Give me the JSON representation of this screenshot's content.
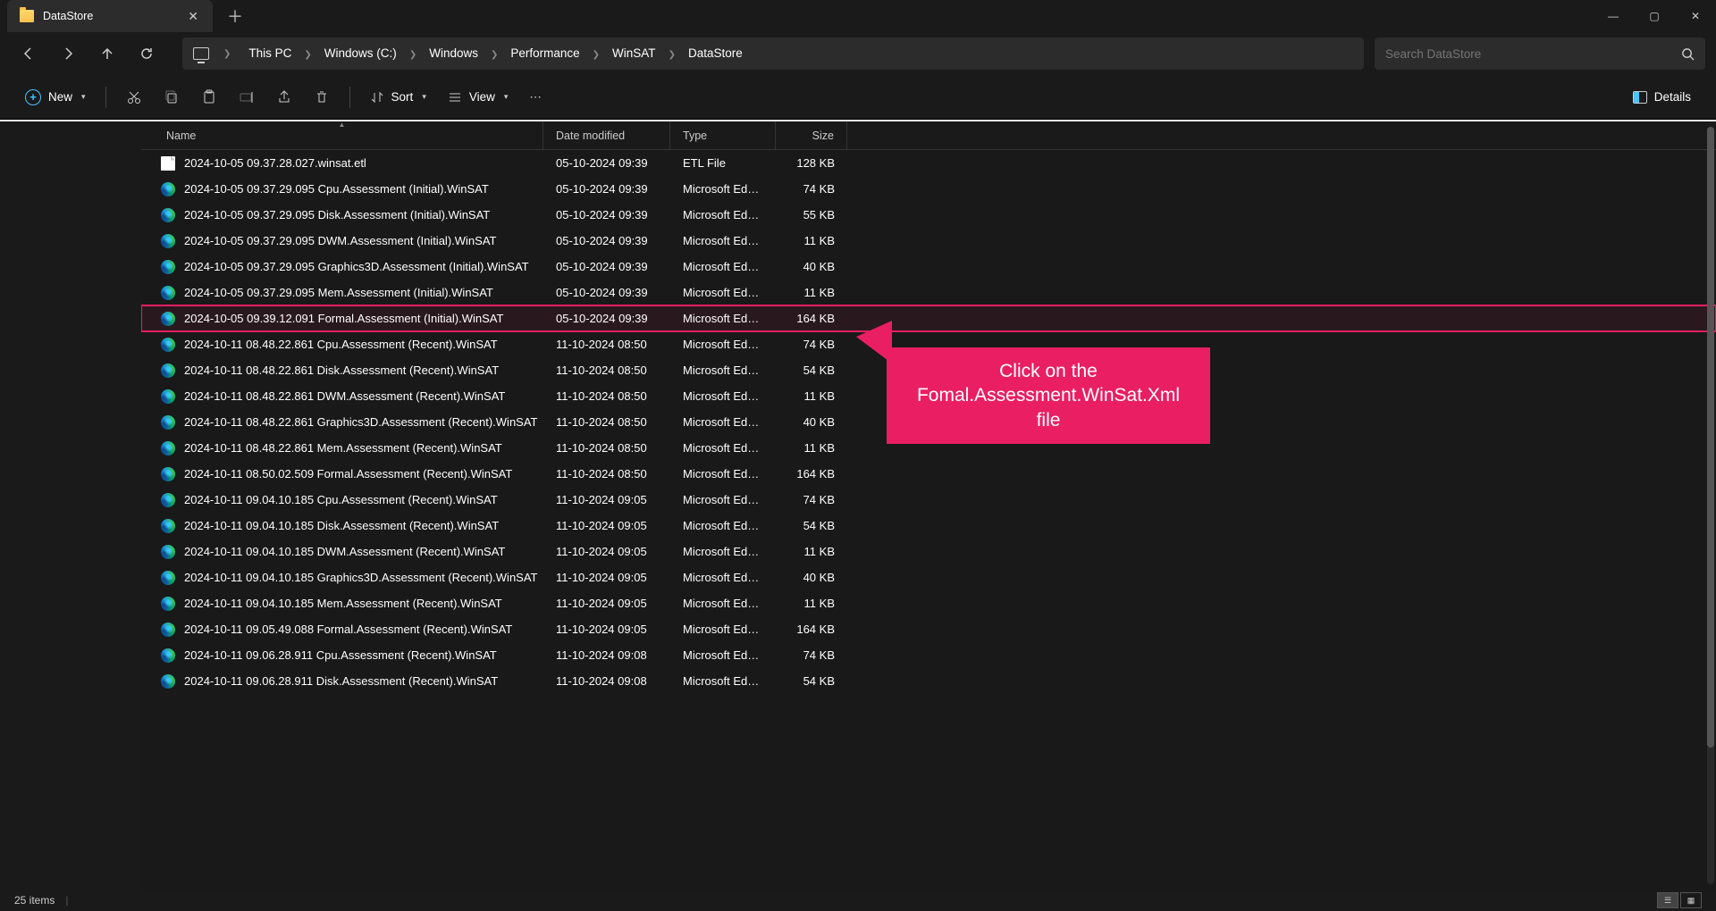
{
  "titlebar": {
    "tab_title": "DataStore"
  },
  "breadcrumb": {
    "items": [
      "This PC",
      "Windows (C:)",
      "Windows",
      "Performance",
      "WinSAT",
      "DataStore"
    ]
  },
  "search": {
    "placeholder": "Search DataStore"
  },
  "toolbar": {
    "new_label": "New",
    "sort_label": "Sort",
    "view_label": "View",
    "details_label": "Details"
  },
  "columns": {
    "name": "Name",
    "date": "Date modified",
    "type": "Type",
    "size": "Size"
  },
  "files": [
    {
      "icon": "etl",
      "name": "2024-10-05 09.37.28.027.winsat.etl",
      "date": "05-10-2024 09:39",
      "type": "ETL File",
      "size": "128 KB",
      "hl": false
    },
    {
      "icon": "edge",
      "name": "2024-10-05 09.37.29.095 Cpu.Assessment (Initial).WinSAT",
      "date": "05-10-2024 09:39",
      "type": "Microsoft Edge HT...",
      "size": "74 KB",
      "hl": false
    },
    {
      "icon": "edge",
      "name": "2024-10-05 09.37.29.095 Disk.Assessment (Initial).WinSAT",
      "date": "05-10-2024 09:39",
      "type": "Microsoft Edge HT...",
      "size": "55 KB",
      "hl": false
    },
    {
      "icon": "edge",
      "name": "2024-10-05 09.37.29.095 DWM.Assessment (Initial).WinSAT",
      "date": "05-10-2024 09:39",
      "type": "Microsoft Edge HT...",
      "size": "11 KB",
      "hl": false
    },
    {
      "icon": "edge",
      "name": "2024-10-05 09.37.29.095 Graphics3D.Assessment (Initial).WinSAT",
      "date": "05-10-2024 09:39",
      "type": "Microsoft Edge HT...",
      "size": "40 KB",
      "hl": false
    },
    {
      "icon": "edge",
      "name": "2024-10-05 09.37.29.095 Mem.Assessment (Initial).WinSAT",
      "date": "05-10-2024 09:39",
      "type": "Microsoft Edge HT...",
      "size": "11 KB",
      "hl": false
    },
    {
      "icon": "edge",
      "name": "2024-10-05 09.39.12.091 Formal.Assessment (Initial).WinSAT",
      "date": "05-10-2024 09:39",
      "type": "Microsoft Edge HT...",
      "size": "164 KB",
      "hl": true
    },
    {
      "icon": "edge",
      "name": "2024-10-11 08.48.22.861 Cpu.Assessment (Recent).WinSAT",
      "date": "11-10-2024 08:50",
      "type": "Microsoft Edge HT...",
      "size": "74 KB",
      "hl": false
    },
    {
      "icon": "edge",
      "name": "2024-10-11 08.48.22.861 Disk.Assessment (Recent).WinSAT",
      "date": "11-10-2024 08:50",
      "type": "Microsoft Edge HT...",
      "size": "54 KB",
      "hl": false
    },
    {
      "icon": "edge",
      "name": "2024-10-11 08.48.22.861 DWM.Assessment (Recent).WinSAT",
      "date": "11-10-2024 08:50",
      "type": "Microsoft Edge HT...",
      "size": "11 KB",
      "hl": false
    },
    {
      "icon": "edge",
      "name": "2024-10-11 08.48.22.861 Graphics3D.Assessment (Recent).WinSAT",
      "date": "11-10-2024 08:50",
      "type": "Microsoft Edge HT...",
      "size": "40 KB",
      "hl": false
    },
    {
      "icon": "edge",
      "name": "2024-10-11 08.48.22.861 Mem.Assessment (Recent).WinSAT",
      "date": "11-10-2024 08:50",
      "type": "Microsoft Edge HT...",
      "size": "11 KB",
      "hl": false
    },
    {
      "icon": "edge",
      "name": "2024-10-11 08.50.02.509 Formal.Assessment (Recent).WinSAT",
      "date": "11-10-2024 08:50",
      "type": "Microsoft Edge HT...",
      "size": "164 KB",
      "hl": false
    },
    {
      "icon": "edge",
      "name": "2024-10-11 09.04.10.185 Cpu.Assessment (Recent).WinSAT",
      "date": "11-10-2024 09:05",
      "type": "Microsoft Edge HT...",
      "size": "74 KB",
      "hl": false
    },
    {
      "icon": "edge",
      "name": "2024-10-11 09.04.10.185 Disk.Assessment (Recent).WinSAT",
      "date": "11-10-2024 09:05",
      "type": "Microsoft Edge HT...",
      "size": "54 KB",
      "hl": false
    },
    {
      "icon": "edge",
      "name": "2024-10-11 09.04.10.185 DWM.Assessment (Recent).WinSAT",
      "date": "11-10-2024 09:05",
      "type": "Microsoft Edge HT...",
      "size": "11 KB",
      "hl": false
    },
    {
      "icon": "edge",
      "name": "2024-10-11 09.04.10.185 Graphics3D.Assessment (Recent).WinSAT",
      "date": "11-10-2024 09:05",
      "type": "Microsoft Edge HT...",
      "size": "40 KB",
      "hl": false
    },
    {
      "icon": "edge",
      "name": "2024-10-11 09.04.10.185 Mem.Assessment (Recent).WinSAT",
      "date": "11-10-2024 09:05",
      "type": "Microsoft Edge HT...",
      "size": "11 KB",
      "hl": false
    },
    {
      "icon": "edge",
      "name": "2024-10-11 09.05.49.088 Formal.Assessment (Recent).WinSAT",
      "date": "11-10-2024 09:05",
      "type": "Microsoft Edge HT...",
      "size": "164 KB",
      "hl": false
    },
    {
      "icon": "edge",
      "name": "2024-10-11 09.06.28.911 Cpu.Assessment (Recent).WinSAT",
      "date": "11-10-2024 09:08",
      "type": "Microsoft Edge HT...",
      "size": "74 KB",
      "hl": false
    },
    {
      "icon": "edge",
      "name": "2024-10-11 09.06.28.911 Disk.Assessment (Recent).WinSAT",
      "date": "11-10-2024 09:08",
      "type": "Microsoft Edge HT...",
      "size": "54 KB",
      "hl": false
    }
  ],
  "status": {
    "count": "25 items"
  },
  "callout": {
    "text": "Click on the Fomal.Assessment.WinSat.Xml file"
  }
}
